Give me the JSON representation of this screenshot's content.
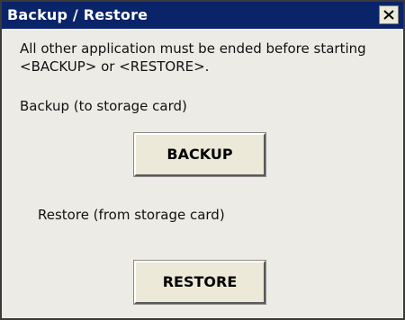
{
  "window": {
    "title": "Backup / Restore",
    "close_icon": "close-icon"
  },
  "message": "All other application must be ended before starting <BACKUP> or <RESTORE>.",
  "backup": {
    "label": "Backup (to storage card)",
    "button_label": "BACKUP"
  },
  "restore": {
    "label": "Restore (from storage card)",
    "button_label": "RESTORE"
  },
  "colors": {
    "titlebar": "#0a246a",
    "window_bg": "#ecebe6",
    "button_bg": "#ece9d8"
  }
}
